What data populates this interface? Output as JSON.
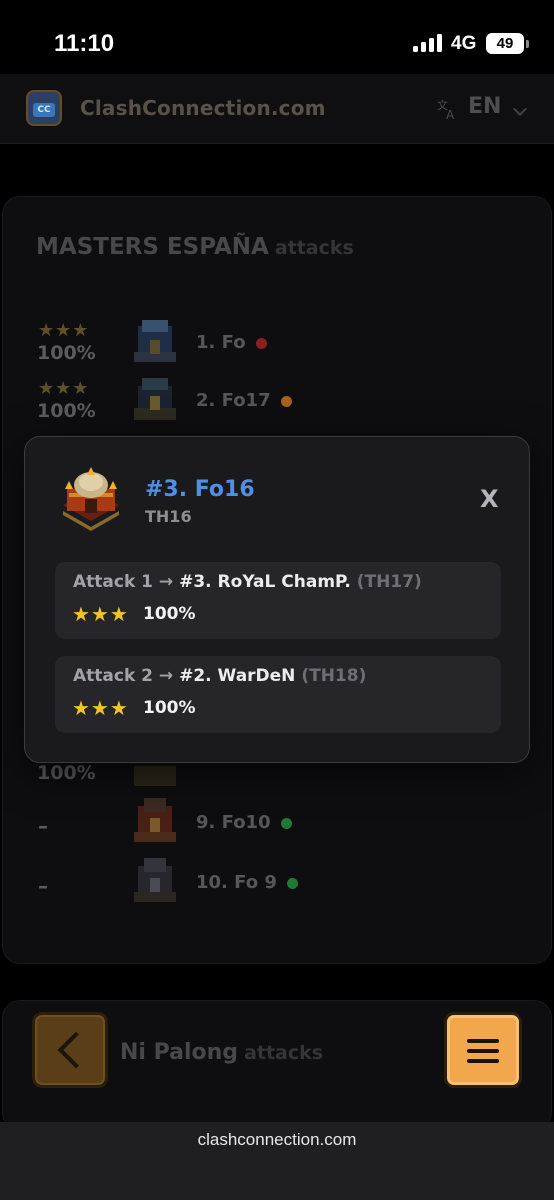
{
  "status_bar": {
    "time": "11:10",
    "network": "4G",
    "battery": "49"
  },
  "header": {
    "logo_text": "CC",
    "brand": "ClashConnection.com",
    "language": "EN",
    "translate_icon": "translate-icon"
  },
  "clan1": {
    "name": "MASTERS ESPAÑA",
    "suffix": "attacks",
    "rows": [
      {
        "stars": "★★★",
        "percent": "100%",
        "player": "1. Fo",
        "dot_color": "#8b1f1f"
      },
      {
        "stars": "★★★",
        "percent": "100%",
        "player": "2. Fo17",
        "dot_color": "#a8601c"
      },
      {
        "stars": "",
        "percent": "100%",
        "player": "",
        "dot_color": ""
      },
      {
        "stars": "",
        "dash": "–",
        "player": "9. Fo10",
        "dot_color": "#1f7a33"
      },
      {
        "stars": "",
        "dash": "–",
        "player": "10. Fo 9",
        "dot_color": "#1f7a33"
      }
    ]
  },
  "clan2": {
    "name": "Ni Palong",
    "suffix": "attacks"
  },
  "modal": {
    "title": "#3. Fo16",
    "subtitle": "TH16",
    "close_label": "X",
    "attacks": [
      {
        "label": "Attack 1 → ",
        "target": "#3. RoYaL ChamP.",
        "target_th": "(TH17)",
        "stars": "★★★",
        "percent": "100%"
      },
      {
        "label": "Attack 2 → ",
        "target": "#2. WarDeN",
        "target_th": "(TH18)",
        "stars": "★★★",
        "percent": "100%"
      }
    ]
  },
  "browser": {
    "url": "clashconnection.com"
  },
  "colors": {
    "accent_blue": "#4f8fe6",
    "star_gold": "#f3c428",
    "menu_orange": "#f2a74c"
  }
}
